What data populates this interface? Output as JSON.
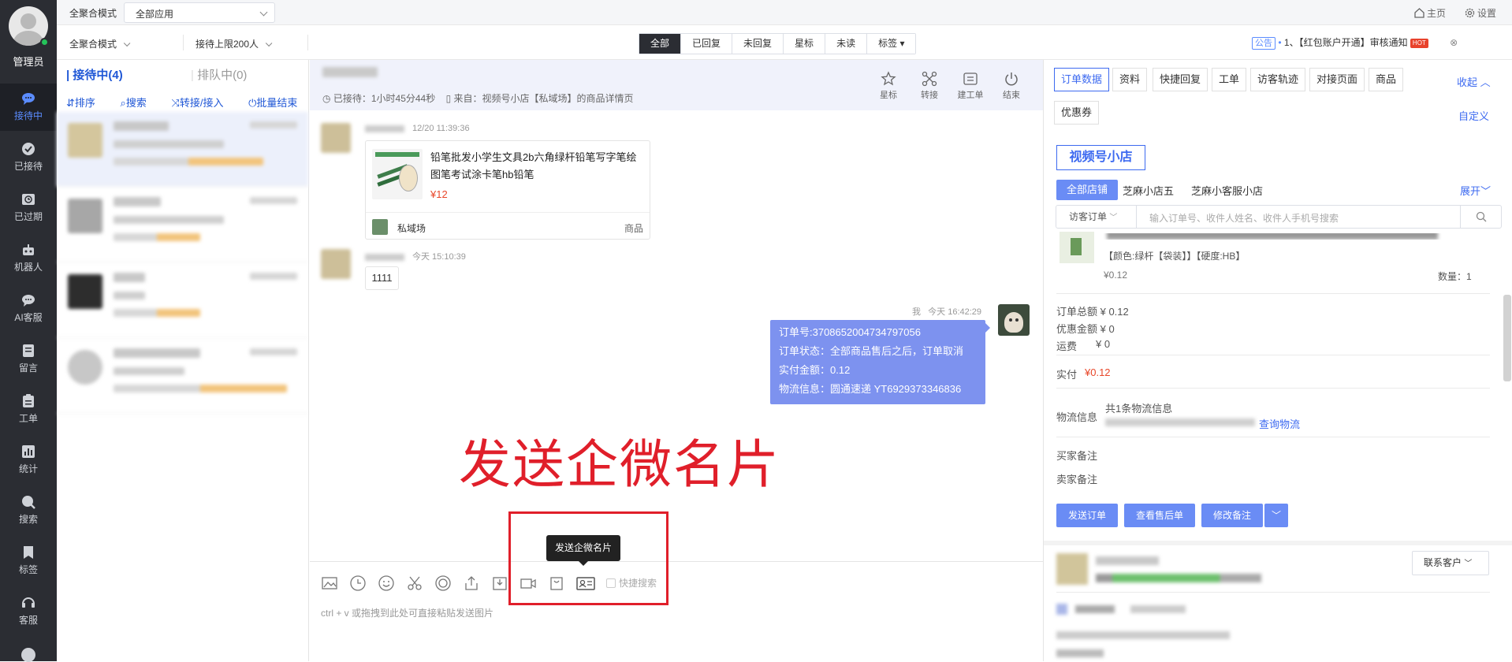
{
  "nav": {
    "admin": "管理员",
    "items": [
      {
        "label": "接待中",
        "icon": "chat-bubble-icon"
      },
      {
        "label": "已接待",
        "icon": "check-circle-icon"
      },
      {
        "label": "已过期",
        "icon": "clock-icon"
      },
      {
        "label": "机器人",
        "icon": "robot-icon"
      },
      {
        "label": "AI客服",
        "icon": "ai-chat-icon"
      },
      {
        "label": "留言",
        "icon": "message-icon"
      },
      {
        "label": "工单",
        "icon": "ticket-icon"
      },
      {
        "label": "统计",
        "icon": "chart-icon"
      },
      {
        "label": "搜索",
        "icon": "search-icon"
      },
      {
        "label": "标签",
        "icon": "bookmark-icon"
      },
      {
        "label": "客服",
        "icon": "headset-icon"
      }
    ]
  },
  "topbar": {
    "mode_label": "全聚合模式",
    "app_select": "全部应用",
    "home": "主页",
    "settings": "设置"
  },
  "filterbar": {
    "mode_select": "全聚合模式",
    "limit_select": "接待上限200人",
    "tabs": [
      "全部",
      "已回复",
      "未回复",
      "星标",
      "未读",
      "标签"
    ],
    "notice_tag": "公告",
    "notice_text": "1、【红包账户开通】审核通知",
    "notice_hot": "HOT"
  },
  "session_list": {
    "tab_active": "接待中(4)",
    "tab_queue": "排队中(0)",
    "ops": [
      "排序",
      "搜索",
      "转接/接入",
      "批量结束"
    ]
  },
  "chat": {
    "header_meta_wait": "已接待：",
    "header_meta_duration": "1小时45分44秒",
    "header_meta_source": "来自：视频号小店【私域场】的商品详情页",
    "actions": [
      "星标",
      "转接",
      "建工单",
      "结束"
    ],
    "msg1_time": "12/20 11:39:36",
    "product_title": "铅笔批发小学生文具2b六角绿杆铅笔写字笔绘图笔考试涂卡笔hb铅笔",
    "product_price": "¥12",
    "product_source": "私域场",
    "product_type": "商品",
    "msg2_time": "今天 15:10:39",
    "msg2_text": "1111",
    "me_label": "我",
    "msg3_time": "今天 16:42:29",
    "order_lines": [
      "订单号:3708652004734797056",
      "订单状态：全部商品售后之后，订单取消",
      "实付金额：0.12",
      "物流信息：圆通速递 YT6929373346836"
    ],
    "annotation": "发送企微名片",
    "tooltip": "发送企微名片",
    "quick_search": "快捷搜索",
    "editor_placeholder": "ctrl + v 或拖拽到此处可直接粘贴发送图片"
  },
  "right": {
    "tabs": [
      "订单数据",
      "资料",
      "快捷回复",
      "工单",
      "访客轨迹",
      "对接页面",
      "商品",
      "优惠券"
    ],
    "collapse": "收起",
    "customize": "自定义",
    "shop_box": "视频号小店",
    "shop_tabs": [
      "全部店铺",
      "芝麻小店五",
      "芝麻小客服小店"
    ],
    "expand": "展开",
    "search_type": "访客订单",
    "search_placeholder": "输入订单号、收件人姓名、收件人手机号搜索",
    "item_spec": "【颜色:绿杆【袋装】】【硬度:HB】",
    "item_price": "¥0.12",
    "item_qty": "数量：1",
    "order_total": "订单总额 ¥ 0.12",
    "discount": "优惠金额 ¥ 0",
    "freight_label": "运费",
    "freight_value": "¥ 0",
    "paid_label": "实付",
    "paid_value": "¥0.12",
    "logistics_label": "物流信息",
    "logistics_count": "共1条物流信息",
    "logistics_link": "查询物流",
    "buyer_note": "买家备注",
    "seller_note": "卖家备注",
    "btn_send": "发送订单",
    "btn_aftersale": "查看售后单",
    "btn_remark": "修改备注",
    "contact": "联系客户"
  }
}
